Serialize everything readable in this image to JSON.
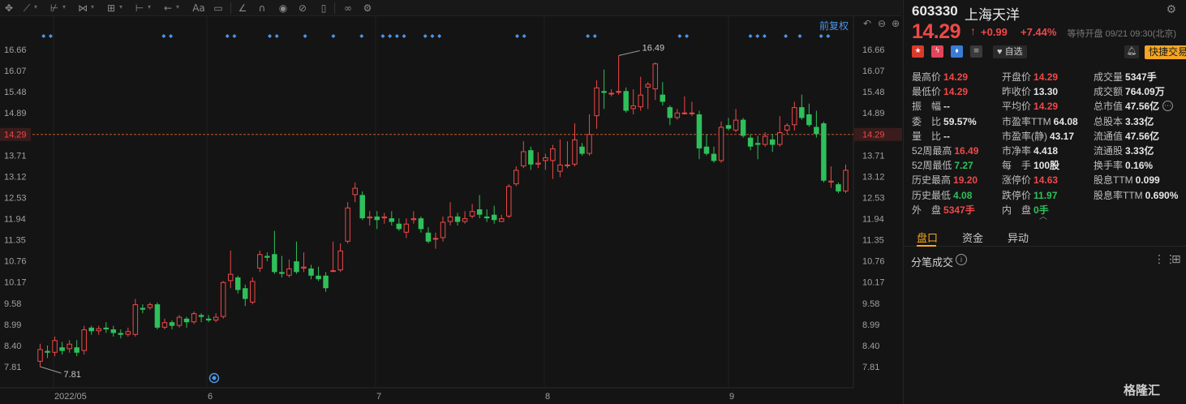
{
  "toolbar": {
    "icons": [
      "move-icon",
      "line-icon",
      "trend-icon",
      "wave-icon",
      "fib-icon",
      "range-icon",
      "arrow-icon",
      "text-icon",
      "comment-icon",
      "ruler-icon",
      "magnet-icon",
      "eye-icon",
      "hide-icon",
      "delete-icon",
      "link-icon",
      "gear-icon"
    ],
    "text_tool": "Aa"
  },
  "chart": {
    "mode_label": "前复权",
    "current_price_label": "14.29",
    "high_label": "16.49",
    "low_label": "7.81",
    "x_labels": [
      "2022/05",
      "6",
      "7",
      "8",
      "9"
    ]
  },
  "chart_data": {
    "type": "candlestick",
    "y_ticks": [
      16.66,
      16.07,
      15.48,
      14.89,
      14.29,
      13.71,
      13.12,
      12.53,
      11.94,
      11.35,
      10.76,
      10.17,
      9.58,
      8.99,
      8.4,
      7.81
    ],
    "ylim": [
      7.5,
      17.0
    ],
    "current_price": 14.29,
    "period_high": 16.49,
    "period_low": 7.81,
    "x_tick_labels": [
      "2022/05",
      "6",
      "7",
      "8",
      "9"
    ],
    "candles": [
      [
        7.95,
        8.3,
        8.45,
        7.81
      ],
      [
        8.25,
        8.2,
        8.4,
        8.05
      ],
      [
        8.2,
        8.55,
        8.65,
        8.1
      ],
      [
        8.35,
        8.25,
        8.5,
        8.15
      ],
      [
        8.3,
        8.45,
        8.55,
        8.2
      ],
      [
        8.35,
        8.2,
        8.55,
        8.1
      ],
      [
        8.25,
        8.85,
        8.95,
        8.15
      ],
      [
        8.9,
        8.8,
        8.95,
        8.7
      ],
      [
        8.8,
        8.88,
        8.95,
        8.7
      ],
      [
        8.9,
        8.85,
        9.05,
        8.75
      ],
      [
        8.85,
        8.75,
        8.95,
        8.65
      ],
      [
        8.75,
        8.7,
        8.85,
        8.6
      ],
      [
        8.7,
        8.8,
        8.9,
        8.65
      ],
      [
        8.7,
        9.55,
        9.7,
        8.65
      ],
      [
        9.45,
        9.4,
        9.55,
        9.3
      ],
      [
        9.45,
        9.55,
        9.6,
        9.4
      ],
      [
        9.55,
        8.9,
        9.6,
        8.85
      ],
      [
        8.9,
        9.05,
        9.15,
        8.85
      ],
      [
        9.05,
        8.95,
        9.1,
        8.85
      ],
      [
        8.95,
        9.2,
        9.25,
        8.9
      ],
      [
        9.15,
        9.05,
        9.2,
        8.9
      ],
      [
        9.05,
        9.3,
        9.35,
        9.0
      ],
      [
        9.25,
        9.2,
        9.3,
        9.05
      ],
      [
        9.15,
        9.1,
        9.25,
        9.05
      ],
      [
        9.1,
        9.2,
        9.3,
        9.05
      ],
      [
        9.2,
        10.17,
        10.2,
        9.15
      ],
      [
        10.2,
        10.4,
        11.05,
        10.0
      ],
      [
        10.3,
        9.95,
        10.35,
        9.85
      ],
      [
        10.0,
        9.7,
        10.1,
        9.5
      ],
      [
        9.6,
        10.2,
        10.3,
        9.55
      ],
      [
        10.55,
        10.95,
        11.05,
        10.45
      ],
      [
        10.9,
        10.85,
        11.0,
        10.75
      ],
      [
        10.95,
        10.45,
        11.6,
        10.4
      ],
      [
        10.45,
        10.4,
        10.9,
        10.3
      ],
      [
        10.35,
        10.55,
        10.8,
        10.3
      ],
      [
        10.75,
        10.45,
        11.3,
        10.4
      ],
      [
        10.55,
        10.6,
        11.0,
        10.45
      ],
      [
        10.55,
        10.35,
        10.65,
        10.25
      ],
      [
        10.35,
        10.25,
        10.6,
        10.2
      ],
      [
        10.35,
        10.0,
        10.45,
        9.9
      ],
      [
        10.5,
        10.5,
        11.3,
        10.45
      ],
      [
        10.5,
        11.05,
        11.25,
        10.45
      ],
      [
        11.3,
        12.25,
        12.4,
        11.25
      ],
      [
        12.6,
        12.8,
        12.95,
        12.4
      ],
      [
        12.6,
        11.95,
        12.7,
        11.9
      ],
      [
        11.95,
        12.0,
        12.15,
        11.75
      ],
      [
        12.0,
        11.9,
        12.15,
        11.65
      ],
      [
        11.95,
        12.0,
        12.1,
        11.8
      ],
      [
        11.95,
        11.85,
        12.15,
        11.75
      ],
      [
        11.8,
        11.65,
        11.95,
        11.6
      ],
      [
        11.55,
        11.8,
        11.95,
        11.4
      ],
      [
        11.9,
        11.95,
        12.15,
        11.8
      ],
      [
        11.95,
        11.65,
        12.0,
        11.55
      ],
      [
        11.55,
        11.3,
        11.7,
        11.25
      ],
      [
        11.4,
        11.4,
        11.55,
        11.1
      ],
      [
        11.4,
        11.85,
        12.0,
        11.3
      ],
      [
        11.85,
        12.0,
        12.4,
        11.75
      ],
      [
        12.0,
        11.85,
        12.1,
        11.75
      ],
      [
        11.85,
        11.95,
        12.15,
        11.8
      ],
      [
        12.0,
        12.15,
        12.35,
        11.95
      ],
      [
        12.2,
        12.05,
        12.6,
        11.95
      ],
      [
        12.0,
        11.95,
        12.2,
        11.85
      ],
      [
        12.05,
        11.9,
        12.3,
        11.8
      ],
      [
        11.85,
        11.95,
        12.05,
        11.85
      ],
      [
        12.0,
        12.85,
        12.9,
        11.95
      ],
      [
        12.9,
        13.3,
        13.4,
        12.85
      ],
      [
        13.4,
        13.82,
        14.1,
        13.35
      ],
      [
        13.85,
        13.45,
        13.95,
        13.3
      ],
      [
        13.45,
        13.5,
        13.8,
        13.35
      ],
      [
        13.55,
        13.65,
        13.75,
        13.3
      ],
      [
        13.55,
        13.9,
        14.0,
        13.05
      ],
      [
        13.25,
        13.45,
        14.15,
        13.1
      ],
      [
        13.45,
        13.45,
        14.1,
        13.35
      ],
      [
        13.45,
        14.15,
        14.6,
        13.4
      ],
      [
        13.95,
        13.75,
        14.05,
        13.7
      ],
      [
        13.75,
        14.3,
        14.85,
        13.7
      ],
      [
        14.8,
        15.6,
        15.8,
        14.45
      ],
      [
        15.5,
        15.45,
        16.1,
        15.0
      ],
      [
        15.45,
        15.45,
        15.55,
        15.35
      ],
      [
        15.5,
        15.5,
        16.49,
        15.4
      ],
      [
        15.5,
        14.95,
        15.6,
        14.9
      ],
      [
        15.0,
        15.1,
        15.55,
        14.85
      ],
      [
        15.05,
        15.4,
        15.9,
        14.95
      ],
      [
        15.6,
        15.7,
        15.75,
        15.0
      ],
      [
        15.55,
        16.27,
        16.3,
        15.25
      ],
      [
        15.4,
        15.2,
        15.75,
        15.1
      ],
      [
        15.05,
        14.75,
        15.1,
        14.55
      ],
      [
        14.75,
        14.9,
        15.0,
        14.7
      ],
      [
        14.9,
        14.9,
        15.35,
        14.85
      ],
      [
        14.9,
        14.9,
        15.2,
        14.8
      ],
      [
        14.85,
        13.9,
        14.95,
        13.6
      ],
      [
        13.95,
        13.75,
        14.3,
        13.7
      ],
      [
        13.75,
        13.55,
        13.95,
        13.5
      ],
      [
        13.55,
        14.5,
        14.65,
        13.5
      ],
      [
        14.55,
        14.45,
        14.75,
        14.4
      ],
      [
        14.4,
        14.7,
        15.0,
        14.35
      ],
      [
        14.7,
        14.25,
        14.75,
        14.2
      ],
      [
        14.2,
        13.95,
        14.3,
        13.85
      ],
      [
        14.05,
        14.0,
        14.25,
        13.6
      ],
      [
        14.0,
        14.25,
        14.35,
        13.95
      ],
      [
        14.15,
        14.0,
        14.3,
        13.8
      ],
      [
        14.0,
        14.35,
        14.8,
        13.95
      ],
      [
        14.4,
        14.55,
        14.6,
        14.3
      ],
      [
        14.55,
        15.05,
        15.2,
        14.4
      ],
      [
        15.05,
        14.75,
        15.4,
        14.7
      ],
      [
        14.85,
        14.55,
        15.15,
        14.5
      ],
      [
        14.5,
        14.3,
        14.95,
        14.2
      ],
      [
        14.6,
        13.0,
        14.65,
        12.95
      ],
      [
        12.95,
        13.0,
        13.4,
        12.8
      ],
      [
        12.9,
        12.7,
        12.95,
        12.65
      ],
      [
        12.7,
        13.3,
        13.45,
        12.65
      ]
    ],
    "dot_columns": [
      1,
      2,
      18,
      19,
      27,
      28,
      33,
      34,
      38,
      42,
      46,
      49,
      50,
      51,
      52,
      55,
      56,
      57,
      68,
      69,
      78,
      79,
      91,
      92,
      101,
      102,
      103,
      106,
      108,
      111,
      112
    ]
  },
  "panel": {
    "code": "603330",
    "name": "上海天洋",
    "price": "14.29",
    "arrow": "↑",
    "change": "+0.99",
    "change_pct": "+7.44%",
    "status": "等待开盘 09/21 09:30(北京)",
    "watch_label": "自选",
    "trade_label": "快捷交易",
    "stats": [
      {
        "label": "最高价",
        "value": "14.29",
        "color": "red"
      },
      {
        "label": "开盘价",
        "value": "14.29",
        "color": "red"
      },
      {
        "label": "成交量",
        "value": "5347手",
        "color": "white"
      },
      {
        "label": "最低价",
        "value": "14.29",
        "color": "red"
      },
      {
        "label": "昨收价",
        "value": "13.30",
        "color": "white"
      },
      {
        "label": "成交额",
        "value": "764.09万",
        "color": "white"
      },
      {
        "label": "振　幅",
        "value": "--",
        "color": "white"
      },
      {
        "label": "平均价",
        "value": "14.29",
        "color": "red"
      },
      {
        "label": "总市值",
        "value": "47.56亿",
        "color": "white"
      },
      {
        "label": "委　比",
        "value": "59.57%",
        "color": "white"
      },
      {
        "label": "市盈率TTM",
        "value": "64.08",
        "color": "white"
      },
      {
        "label": "总股本",
        "value": "3.33亿",
        "color": "white"
      },
      {
        "label": "量　比",
        "value": "--",
        "color": "white"
      },
      {
        "label": "市盈率(静)",
        "value": "43.17",
        "color": "white"
      },
      {
        "label": "流通值",
        "value": "47.56亿",
        "color": "white"
      },
      {
        "label": "52周最高",
        "value": "16.49",
        "color": "red"
      },
      {
        "label": "市净率",
        "value": "4.418",
        "color": "white"
      },
      {
        "label": "流通股",
        "value": "3.33亿",
        "color": "white"
      },
      {
        "label": "52周最低",
        "value": "7.27",
        "color": "green"
      },
      {
        "label": "每　手",
        "value": "100股",
        "color": "white"
      },
      {
        "label": "换手率",
        "value": "0.16%",
        "color": "white"
      },
      {
        "label": "历史最高",
        "value": "19.20",
        "color": "red"
      },
      {
        "label": "涨停价",
        "value": "14.63",
        "color": "red"
      },
      {
        "label": "股息TTM",
        "value": "0.099",
        "color": "white"
      },
      {
        "label": "历史最低",
        "value": "4.08",
        "color": "green"
      },
      {
        "label": "跌停价",
        "value": "11.97",
        "color": "green"
      },
      {
        "label": "股息率TTM",
        "value": "0.690%",
        "color": "white"
      },
      {
        "label": "外　盘",
        "value": "5347手",
        "color": "red"
      },
      {
        "label": "内　盘",
        "value": "0手",
        "color": "green"
      }
    ],
    "tabs": [
      "盘口",
      "资金",
      "异动"
    ],
    "ticks_title": "分笔成交",
    "brand": "格隆汇"
  },
  "colors": {
    "up": "#f04848",
    "down": "#2ec05a",
    "accent": "#f5a623",
    "link": "#4e95e8"
  }
}
